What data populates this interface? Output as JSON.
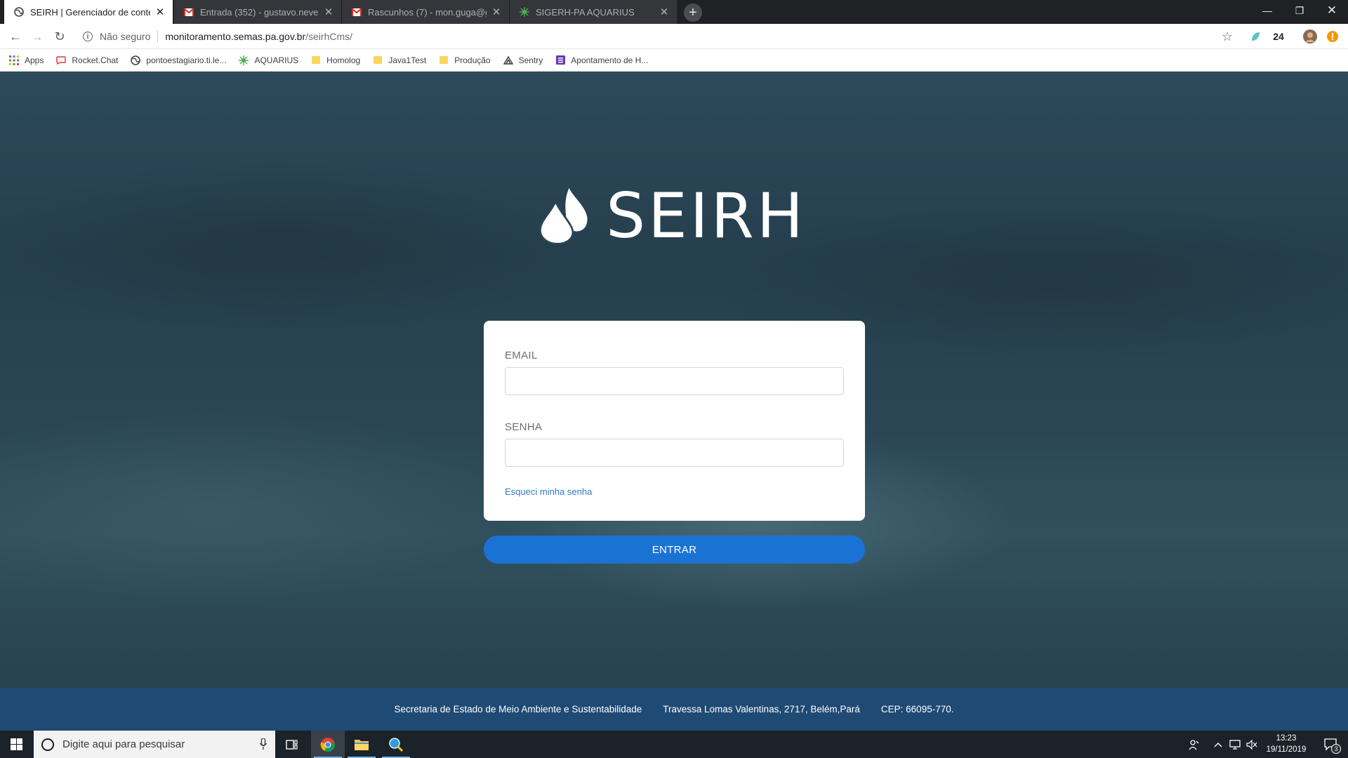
{
  "browser": {
    "tabs": [
      {
        "title": "SEIRH | Gerenciador de conteúdo",
        "active": true,
        "icon": "globe-icon"
      },
      {
        "title": "Entrada (352) - gustavo.neves.lei",
        "active": false,
        "icon": "gmail-icon"
      },
      {
        "title": "Rascunhos (7) - mon.guga@gma",
        "active": false,
        "icon": "gmail-icon"
      },
      {
        "title": "SIGERH-PA AQUARIUS",
        "active": false,
        "icon": "aquarius-icon"
      }
    ],
    "new_tab": "+",
    "address": {
      "security_label": "Não seguro",
      "host": "monitoramento.semas.pa.gov.br",
      "path": "/seirhCms/"
    },
    "extension_badge": "24",
    "bookmarks": [
      {
        "label": "Apps",
        "icon": "apps-grid-icon"
      },
      {
        "label": "Rocket.Chat",
        "icon": "rocketchat-icon"
      },
      {
        "label": "pontoestagiario.ti.le...",
        "icon": "globe-icon"
      },
      {
        "label": "AQUARIUS",
        "icon": "aquarius-icon"
      },
      {
        "label": "Homolog",
        "icon": "folder-icon"
      },
      {
        "label": "Java1Test",
        "icon": "folder-icon"
      },
      {
        "label": "Produção",
        "icon": "folder-icon"
      },
      {
        "label": "Sentry",
        "icon": "sentry-icon"
      },
      {
        "label": "Apontamento de H...",
        "icon": "purple-sheet-icon"
      }
    ]
  },
  "page": {
    "logo_text": "SEIRH",
    "form": {
      "email_label": "EMAIL",
      "email_value": "",
      "password_label": "SENHA",
      "password_value": "",
      "forgot_link": "Esqueci minha senha",
      "submit_label": "ENTRAR"
    },
    "footer": {
      "org": "Secretaria de Estado de Meio Ambiente e Sustentabilidade",
      "address": "Travessa Lomas Valentinas, 2717, Belém,Pará",
      "cep": "CEP: 66095-770."
    }
  },
  "taskbar": {
    "search_placeholder": "Digite aqui para pesquisar",
    "time": "13:23",
    "date": "19/11/2019",
    "notification_count": "3"
  },
  "colors": {
    "primary_button": "#1a73d4",
    "footer_bg": "#1f4a74",
    "link": "#2d7bc8"
  }
}
